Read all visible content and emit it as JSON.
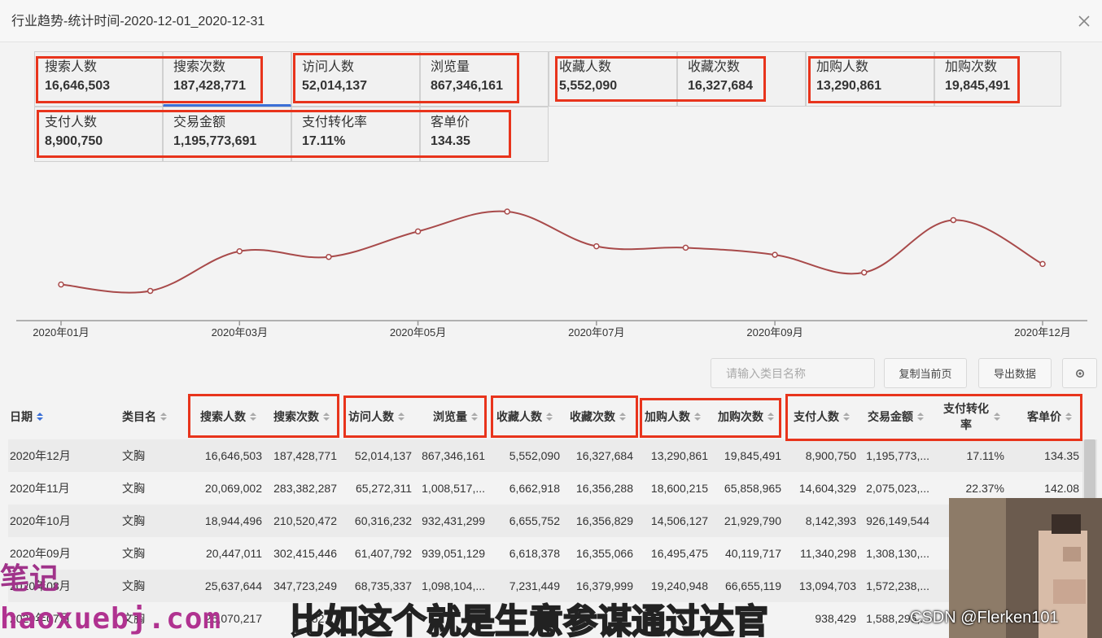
{
  "window": {
    "title": "行业趋势-统计时间-2020-12-01_2020-12-31"
  },
  "metrics": [
    {
      "label": "搜索人数",
      "value": "16,646,503"
    },
    {
      "label": "搜索次数",
      "value": "187,428,771"
    },
    {
      "label": "访问人数",
      "value": "52,014,137"
    },
    {
      "label": "浏览量",
      "value": "867,346,161"
    },
    {
      "label": "收藏人数",
      "value": "5,552,090"
    },
    {
      "label": "收藏次数",
      "value": "16,327,684"
    },
    {
      "label": "加购人数",
      "value": "13,290,861"
    },
    {
      "label": "加购次数",
      "value": "19,845,491"
    },
    {
      "label": "支付人数",
      "value": "8,900,750"
    },
    {
      "label": "交易金额",
      "value": "1,195,773,691"
    },
    {
      "label": "支付转化率",
      "value": "17.11%"
    },
    {
      "label": "客单价",
      "value": "134.35"
    }
  ],
  "chart_data": {
    "type": "line",
    "x": [
      "2020年01月",
      "2020年02月",
      "2020年03月",
      "2020年04月",
      "2020年05月",
      "2020年06月",
      "2020年07月",
      "2020年08月",
      "2020年09月",
      "2020年10月",
      "2020年11月",
      "2020年12月"
    ],
    "series": [
      {
        "values": [
          0.255,
          0.21,
          0.49,
          0.45,
          0.63,
          0.77,
          0.525,
          0.515,
          0.465,
          0.34,
          0.71,
          0.4
        ]
      }
    ],
    "xticks": [
      "2020年01月",
      "2020年03月",
      "2020年05月",
      "2020年07月",
      "2020年09月",
      "2020年12月"
    ],
    "smooth": true,
    "line_color": "#a84a4a",
    "grid": false,
    "legend": "none",
    "ylim": [
      0,
      1
    ]
  },
  "toolbar": {
    "search_placeholder": "请输入类目名称",
    "copy_label": "复制当前页",
    "export_label": "导出数据"
  },
  "table": {
    "headers": [
      "日期",
      "类目名",
      "搜索人数",
      "搜索次数",
      "访问人数",
      "浏览量",
      "收藏人数",
      "收藏次数",
      "加购人数",
      "加购次数",
      "支付人数",
      "交易金额",
      "支付转化率",
      "客单价"
    ],
    "rows": [
      [
        "2020年12月",
        "文胸",
        "16,646,503",
        "187,428,771",
        "52,014,137",
        "867,346,161",
        "5,552,090",
        "16,327,684",
        "13,290,861",
        "19,845,491",
        "8,900,750",
        "1,195,773,...",
        "17.11%",
        "134.35"
      ],
      [
        "2020年11月",
        "文胸",
        "20,069,002",
        "283,382,287",
        "65,272,311",
        "1,008,517,...",
        "6,662,918",
        "16,356,288",
        "18,600,215",
        "65,858,965",
        "14,604,329",
        "2,075,023,...",
        "22.37%",
        "142.08"
      ],
      [
        "2020年10月",
        "文胸",
        "18,944,496",
        "210,520,472",
        "60,316,232",
        "932,431,299",
        "6,655,752",
        "16,356,829",
        "14,506,127",
        "21,929,790",
        "8,142,393",
        "926,149,544",
        "",
        ""
      ],
      [
        "2020年09月",
        "文胸",
        "20,447,011",
        "302,415,446",
        "61,407,792",
        "939,051,129",
        "6,618,378",
        "16,355,066",
        "16,495,475",
        "40,119,717",
        "11,340,298",
        "1,308,130,...",
        "",
        ""
      ],
      [
        "2020年08月",
        "文胸",
        "25,637,644",
        "347,723,249",
        "68,735,337",
        "1,098,104,...",
        "7,231,449",
        "16,379,999",
        "19,240,948",
        "66,655,119",
        "13,094,703",
        "1,572,238,...",
        "",
        ""
      ],
      [
        "2020年07月",
        "文胸",
        "26,070,217",
        "352,...",
        "",
        "",
        "",
        "",
        "",
        "",
        "938,429",
        "1,588,296,...",
        "",
        ""
      ]
    ]
  },
  "overlay": {
    "notes_watermark": "笔记",
    "url_watermark": "haoxuebj.com",
    "subtitle": "比如这个就是生意参谋通过达官",
    "csdn": "CSDN @Flerken101"
  }
}
